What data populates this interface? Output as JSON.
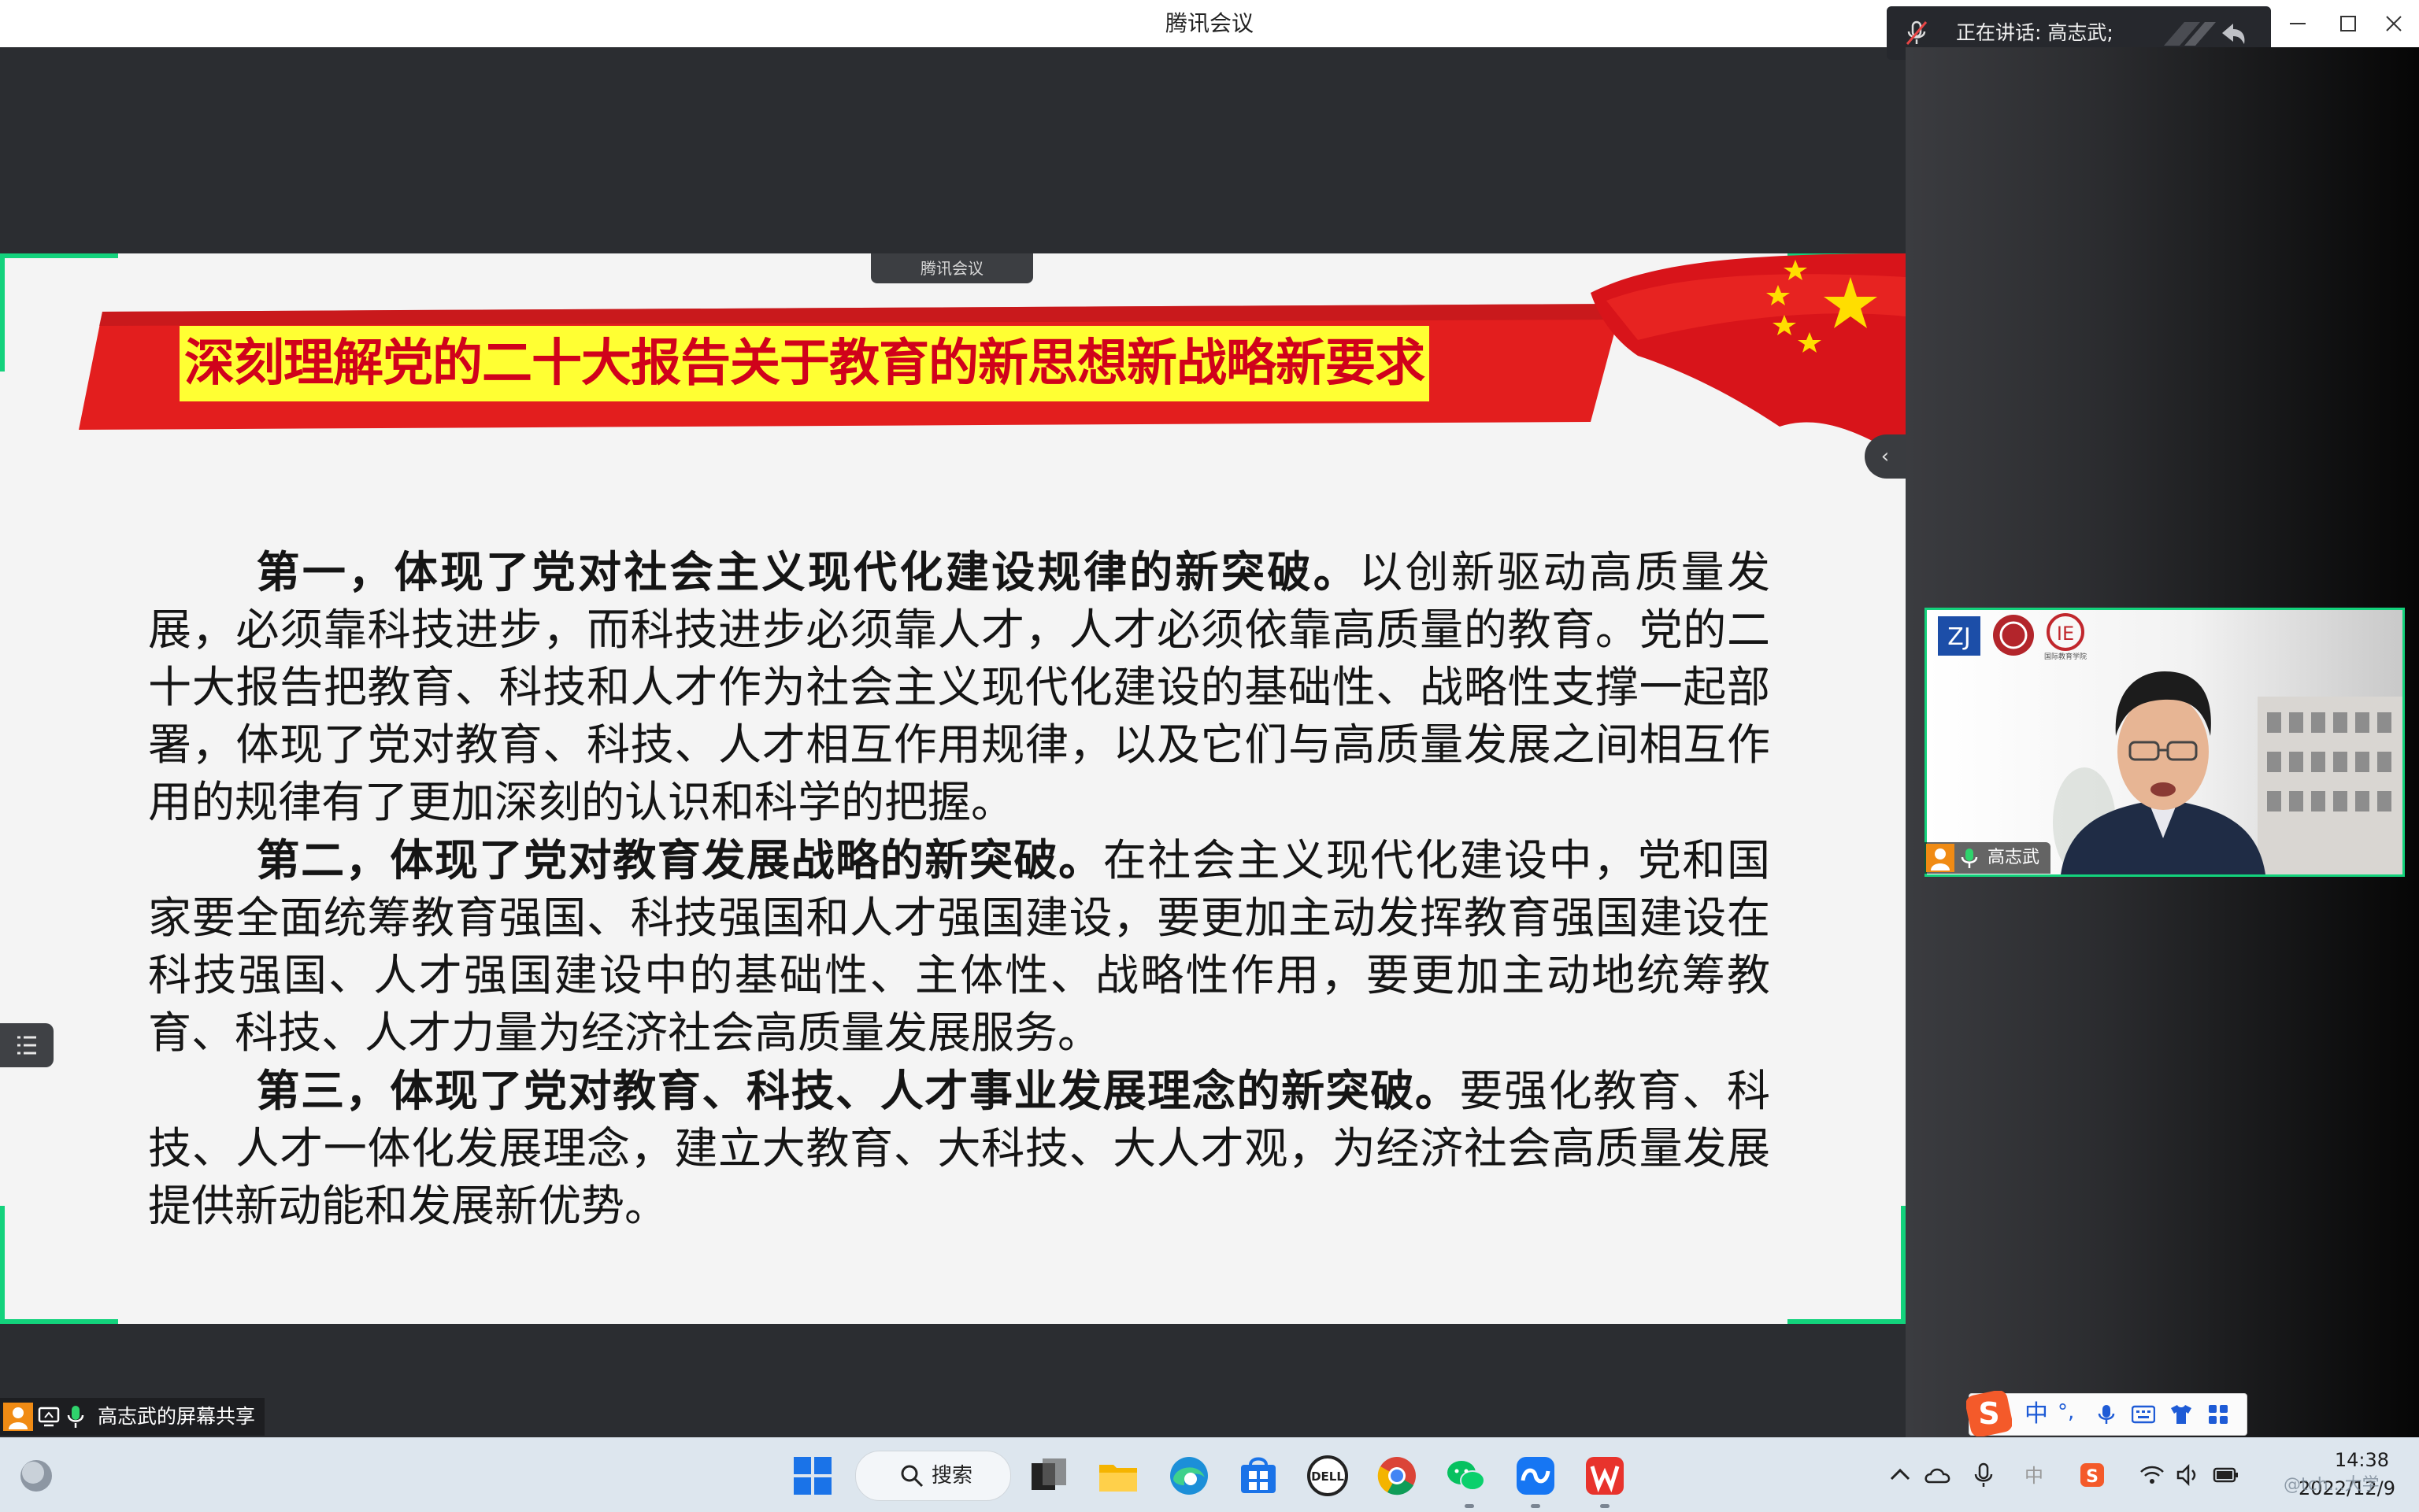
{
  "window": {
    "title": "腾讯会议",
    "minimize_icon": "minimize-icon",
    "maximize_icon": "maximize-icon",
    "close_icon": "close-icon"
  },
  "speaking_bar": {
    "label": "正在讲话: 高志武;",
    "icons": [
      "muted-mic-icon",
      "signal-icon",
      "return-icon"
    ]
  },
  "share": {
    "top_tag": "腾讯会议",
    "label": "高志武的屏幕共享",
    "collapse_icon": "chevron-left-icon",
    "list_icon": "list-icon"
  },
  "slide": {
    "title": "深刻理解党的二十大报告关于教育的新思想新战略新要求",
    "paragraphs": [
      {
        "lead": "第一，体现了党对社会主义现代化建设规律的新突破。",
        "text": "以创新驱动高质量发展，必须靠科技进步，而科技进步必须靠人才，人才必须依靠高质量的教育。党的二十大报告把教育、科技和人才作为社会主义现代化建设的基础性、战略性支撑一起部署，体现了党对教育、科技、人才相互作用规律，以及它们与高质量发展之间相互作用的规律有了更加深刻的认识和科学的把握。"
      },
      {
        "lead": "第二，体现了党对教育发展战略的新突破。",
        "text": "在社会主义现代化建设中，党和国家要全面统筹教育强国、科技强国和人才强国建设，要更加主动发挥教育强国建设在科技强国、人才强国建设中的基础性、主体性、战略性作用，要更加主动地统筹教育、科技、人才力量为经济社会高质量发展服务。"
      },
      {
        "lead": "第三，体现了党对教育、科技、人才事业发展理念的新突破。",
        "text": "要强化教育、科技、人才一体化发展理念，建立大教育、大科技、大人才观，为经济社会高质量发展提供新动能和发展新优势。"
      }
    ]
  },
  "participant": {
    "name": "高志武",
    "logo_caption": "国际教育学院"
  },
  "ime": {
    "mode": "中",
    "punct": "°,"
  },
  "taskbar": {
    "search_label": "搜索",
    "pinned": [
      "windows-start-icon",
      "search-icon",
      "task-view-icon",
      "file-explorer-icon",
      "edge-icon",
      "store-icon",
      "dell-icon",
      "chrome-icon",
      "wechat-icon",
      "tencent-meeting-icon",
      "wps-icon"
    ],
    "time": "14:38",
    "date": "2022/12/9"
  },
  "watermark": "@tch...大学"
}
